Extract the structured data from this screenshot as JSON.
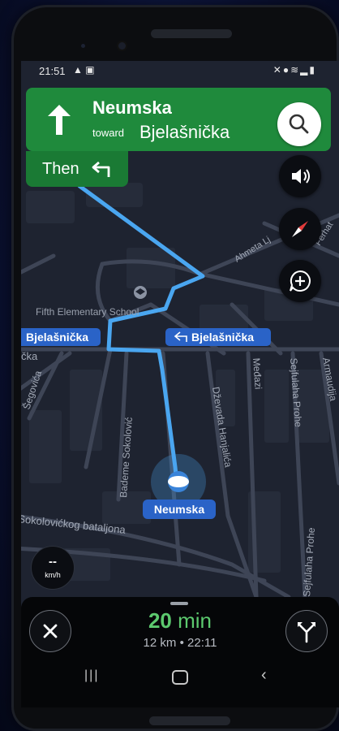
{
  "status_bar": {
    "time": "21:51",
    "left_icons": [
      "navigation-icon",
      "image-icon"
    ],
    "right_icons": [
      "mute-icon",
      "location-icon",
      "wifi-icon",
      "signal-icon",
      "battery-icon"
    ]
  },
  "navigation": {
    "current_street": "Neumska",
    "toward_label": "toward",
    "toward_street": "Bjelašnička",
    "then_label": "Then",
    "then_icon": "turn-left-icon",
    "maneuver_icon": "straight-arrow-icon"
  },
  "map_labels": {
    "school": "Fifth Elementary School",
    "bjelasnicka_left": "Bjelašnička",
    "bjelasnicka_right": "Bjelašnička",
    "cka": "čka",
    "segovica": "Šegovića",
    "bademe": "Bademe Sokolović",
    "dzevada": "Dževada Hanjalića",
    "medjazi": "Međazi",
    "sejfulaha": "Sejfulaha Prohe",
    "armaudija": "Armaudija",
    "ahmeta": "Ahmeta Lj",
    "ferhat": "Ferhat",
    "sokolovickog": "Sokolovićkog bataljona",
    "sejfulaha_lower": "Sejfulaha Prohe",
    "position_label": "Neumska"
  },
  "controls": {
    "search_icon": "search-icon",
    "sound_icon": "volume-icon",
    "compass_icon": "compass-icon",
    "report_icon": "add-report-icon"
  },
  "speedometer": {
    "value": "--",
    "unit": "km/h"
  },
  "trip": {
    "minutes": "20",
    "minutes_unit": "min",
    "distance": "12 km",
    "separator": "•",
    "arrival": "22:11"
  },
  "colors": {
    "nav_green": "#1f8a3c",
    "route_blue": "#4aa6f0",
    "eta_green": "#5cc96e",
    "map_bg": "#1e2330"
  }
}
